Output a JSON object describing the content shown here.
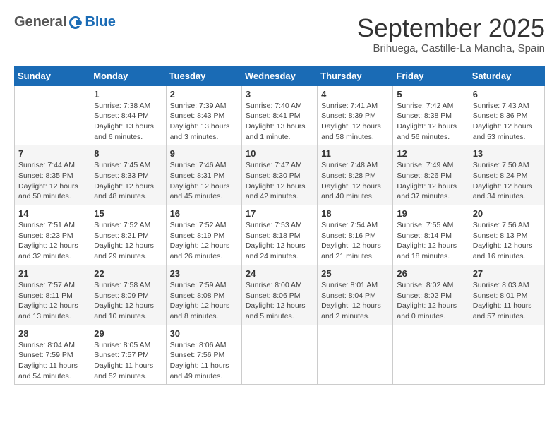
{
  "logo": {
    "line1": "General",
    "line2": "Blue"
  },
  "title": "September 2025",
  "location": "Brihuega, Castille-La Mancha, Spain",
  "weekdays": [
    "Sunday",
    "Monday",
    "Tuesday",
    "Wednesday",
    "Thursday",
    "Friday",
    "Saturday"
  ],
  "weeks": [
    [
      {
        "day": "",
        "sunrise": "",
        "sunset": "",
        "daylight": ""
      },
      {
        "day": "1",
        "sunrise": "Sunrise: 7:38 AM",
        "sunset": "Sunset: 8:44 PM",
        "daylight": "Daylight: 13 hours and 6 minutes."
      },
      {
        "day": "2",
        "sunrise": "Sunrise: 7:39 AM",
        "sunset": "Sunset: 8:43 PM",
        "daylight": "Daylight: 13 hours and 3 minutes."
      },
      {
        "day": "3",
        "sunrise": "Sunrise: 7:40 AM",
        "sunset": "Sunset: 8:41 PM",
        "daylight": "Daylight: 13 hours and 1 minute."
      },
      {
        "day": "4",
        "sunrise": "Sunrise: 7:41 AM",
        "sunset": "Sunset: 8:39 PM",
        "daylight": "Daylight: 12 hours and 58 minutes."
      },
      {
        "day": "5",
        "sunrise": "Sunrise: 7:42 AM",
        "sunset": "Sunset: 8:38 PM",
        "daylight": "Daylight: 12 hours and 56 minutes."
      },
      {
        "day": "6",
        "sunrise": "Sunrise: 7:43 AM",
        "sunset": "Sunset: 8:36 PM",
        "daylight": "Daylight: 12 hours and 53 minutes."
      }
    ],
    [
      {
        "day": "7",
        "sunrise": "Sunrise: 7:44 AM",
        "sunset": "Sunset: 8:35 PM",
        "daylight": "Daylight: 12 hours and 50 minutes."
      },
      {
        "day": "8",
        "sunrise": "Sunrise: 7:45 AM",
        "sunset": "Sunset: 8:33 PM",
        "daylight": "Daylight: 12 hours and 48 minutes."
      },
      {
        "day": "9",
        "sunrise": "Sunrise: 7:46 AM",
        "sunset": "Sunset: 8:31 PM",
        "daylight": "Daylight: 12 hours and 45 minutes."
      },
      {
        "day": "10",
        "sunrise": "Sunrise: 7:47 AM",
        "sunset": "Sunset: 8:30 PM",
        "daylight": "Daylight: 12 hours and 42 minutes."
      },
      {
        "day": "11",
        "sunrise": "Sunrise: 7:48 AM",
        "sunset": "Sunset: 8:28 PM",
        "daylight": "Daylight: 12 hours and 40 minutes."
      },
      {
        "day": "12",
        "sunrise": "Sunrise: 7:49 AM",
        "sunset": "Sunset: 8:26 PM",
        "daylight": "Daylight: 12 hours and 37 minutes."
      },
      {
        "day": "13",
        "sunrise": "Sunrise: 7:50 AM",
        "sunset": "Sunset: 8:24 PM",
        "daylight": "Daylight: 12 hours and 34 minutes."
      }
    ],
    [
      {
        "day": "14",
        "sunrise": "Sunrise: 7:51 AM",
        "sunset": "Sunset: 8:23 PM",
        "daylight": "Daylight: 12 hours and 32 minutes."
      },
      {
        "day": "15",
        "sunrise": "Sunrise: 7:52 AM",
        "sunset": "Sunset: 8:21 PM",
        "daylight": "Daylight: 12 hours and 29 minutes."
      },
      {
        "day": "16",
        "sunrise": "Sunrise: 7:52 AM",
        "sunset": "Sunset: 8:19 PM",
        "daylight": "Daylight: 12 hours and 26 minutes."
      },
      {
        "day": "17",
        "sunrise": "Sunrise: 7:53 AM",
        "sunset": "Sunset: 8:18 PM",
        "daylight": "Daylight: 12 hours and 24 minutes."
      },
      {
        "day": "18",
        "sunrise": "Sunrise: 7:54 AM",
        "sunset": "Sunset: 8:16 PM",
        "daylight": "Daylight: 12 hours and 21 minutes."
      },
      {
        "day": "19",
        "sunrise": "Sunrise: 7:55 AM",
        "sunset": "Sunset: 8:14 PM",
        "daylight": "Daylight: 12 hours and 18 minutes."
      },
      {
        "day": "20",
        "sunrise": "Sunrise: 7:56 AM",
        "sunset": "Sunset: 8:13 PM",
        "daylight": "Daylight: 12 hours and 16 minutes."
      }
    ],
    [
      {
        "day": "21",
        "sunrise": "Sunrise: 7:57 AM",
        "sunset": "Sunset: 8:11 PM",
        "daylight": "Daylight: 12 hours and 13 minutes."
      },
      {
        "day": "22",
        "sunrise": "Sunrise: 7:58 AM",
        "sunset": "Sunset: 8:09 PM",
        "daylight": "Daylight: 12 hours and 10 minutes."
      },
      {
        "day": "23",
        "sunrise": "Sunrise: 7:59 AM",
        "sunset": "Sunset: 8:08 PM",
        "daylight": "Daylight: 12 hours and 8 minutes."
      },
      {
        "day": "24",
        "sunrise": "Sunrise: 8:00 AM",
        "sunset": "Sunset: 8:06 PM",
        "daylight": "Daylight: 12 hours and 5 minutes."
      },
      {
        "day": "25",
        "sunrise": "Sunrise: 8:01 AM",
        "sunset": "Sunset: 8:04 PM",
        "daylight": "Daylight: 12 hours and 2 minutes."
      },
      {
        "day": "26",
        "sunrise": "Sunrise: 8:02 AM",
        "sunset": "Sunset: 8:02 PM",
        "daylight": "Daylight: 12 hours and 0 minutes."
      },
      {
        "day": "27",
        "sunrise": "Sunrise: 8:03 AM",
        "sunset": "Sunset: 8:01 PM",
        "daylight": "Daylight: 11 hours and 57 minutes."
      }
    ],
    [
      {
        "day": "28",
        "sunrise": "Sunrise: 8:04 AM",
        "sunset": "Sunset: 7:59 PM",
        "daylight": "Daylight: 11 hours and 54 minutes."
      },
      {
        "day": "29",
        "sunrise": "Sunrise: 8:05 AM",
        "sunset": "Sunset: 7:57 PM",
        "daylight": "Daylight: 11 hours and 52 minutes."
      },
      {
        "day": "30",
        "sunrise": "Sunrise: 8:06 AM",
        "sunset": "Sunset: 7:56 PM",
        "daylight": "Daylight: 11 hours and 49 minutes."
      },
      {
        "day": "",
        "sunrise": "",
        "sunset": "",
        "daylight": ""
      },
      {
        "day": "",
        "sunrise": "",
        "sunset": "",
        "daylight": ""
      },
      {
        "day": "",
        "sunrise": "",
        "sunset": "",
        "daylight": ""
      },
      {
        "day": "",
        "sunrise": "",
        "sunset": "",
        "daylight": ""
      }
    ]
  ]
}
